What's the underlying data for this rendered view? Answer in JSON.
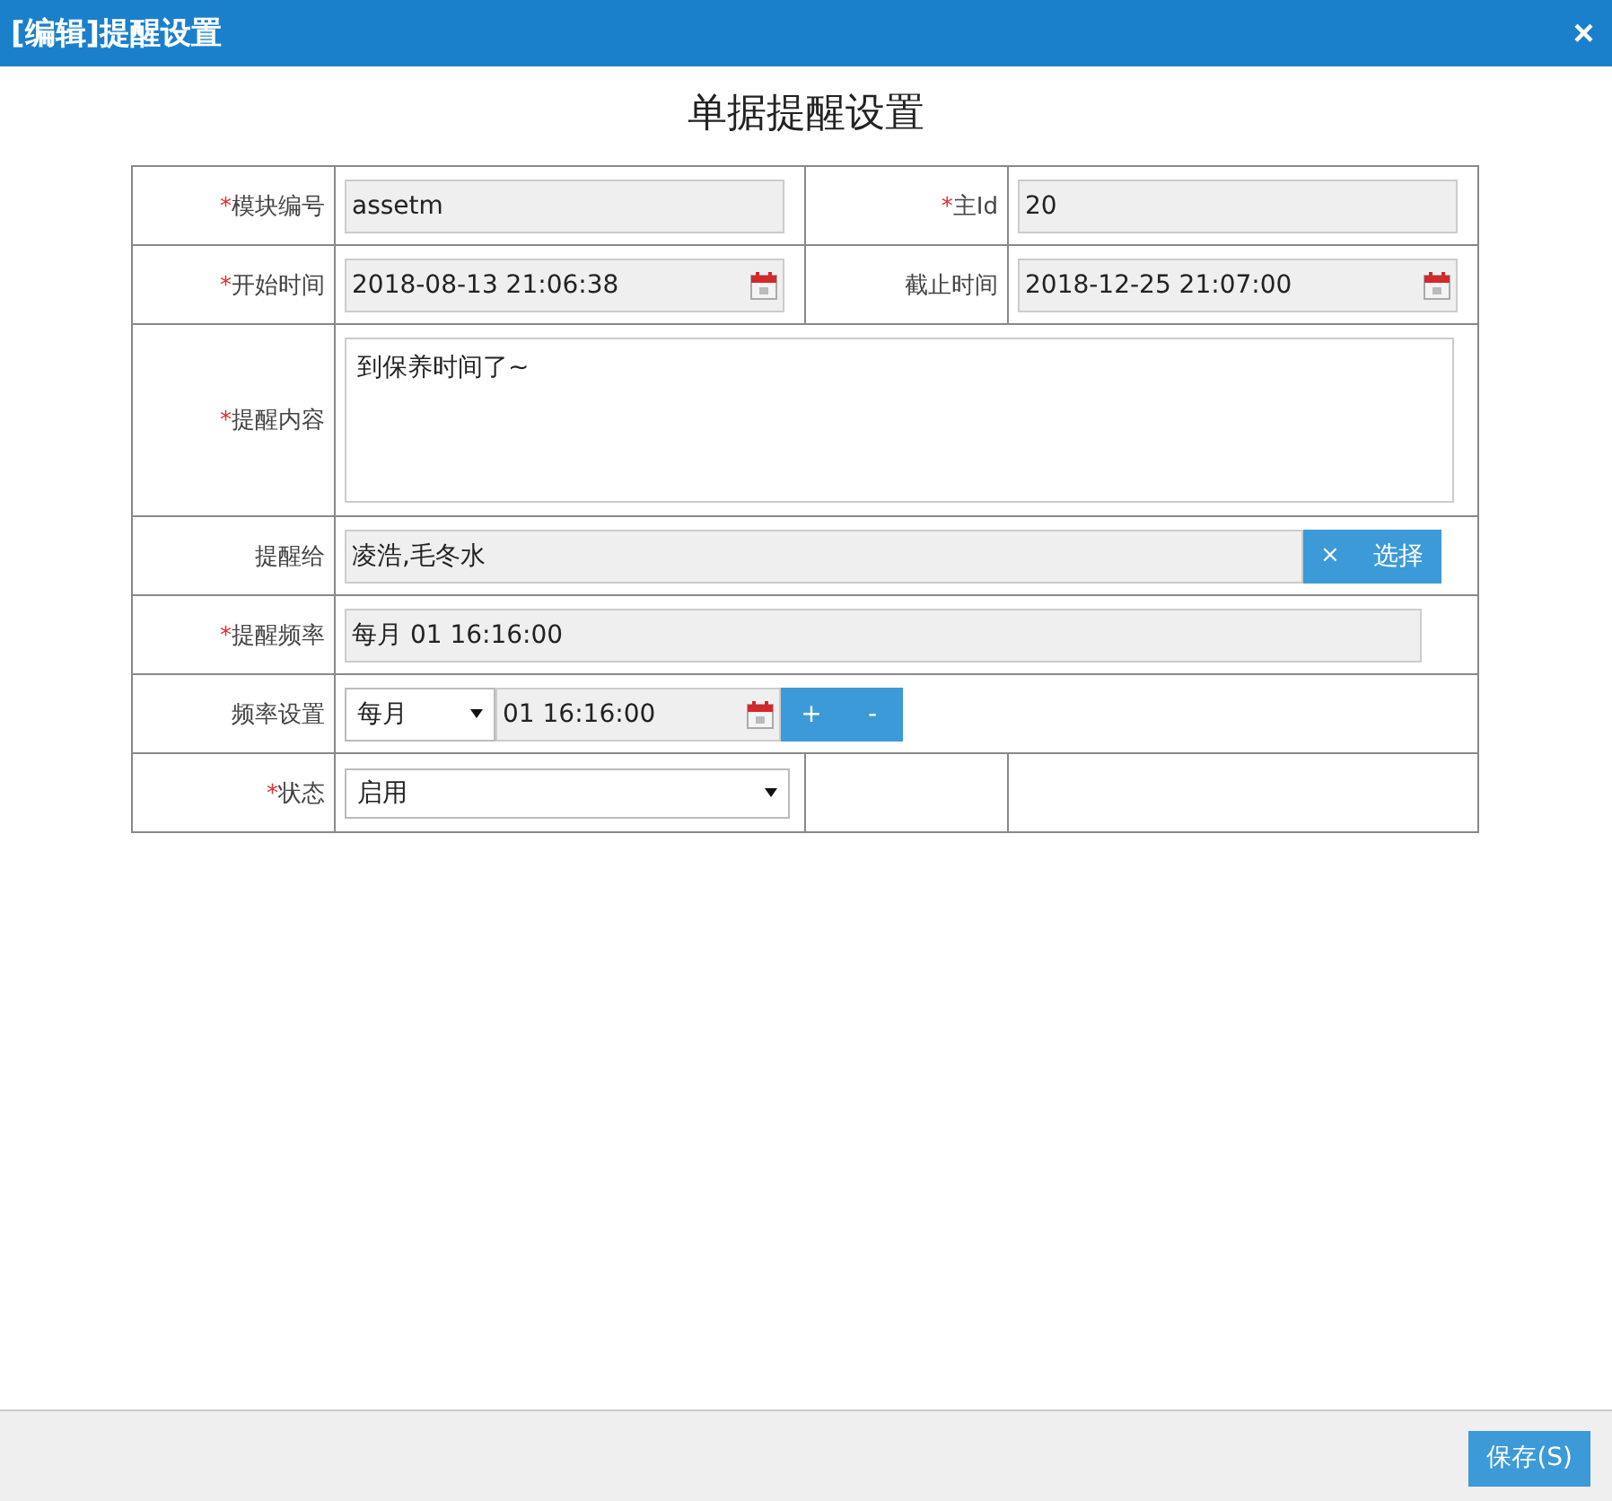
{
  "window": {
    "title": "[编辑]提醒设置",
    "close": "×"
  },
  "form": {
    "title": "单据提醒设置",
    "rows": [
      {
        "kind": "pair",
        "cells": [
          {
            "label": "模块编号",
            "mark": "*",
            "kind": "text",
            "value": "assetm"
          },
          {
            "label": "主Id",
            "mark": "*",
            "kind": "text",
            "value": "20"
          }
        ]
      },
      {
        "kind": "pair",
        "cells": [
          {
            "label": "开始时间",
            "mark": "*",
            "kind": "date",
            "value": "2018-08-13 21:06:38"
          },
          {
            "label": "截止时间",
            "kind": "date",
            "value": "2018-12-25 21:07:00"
          }
        ]
      },
      {
        "kind": "wide",
        "cells": [
          {
            "label": "提醒内容",
            "mark": "*",
            "kind": "textarea",
            "value": "到保养时间了~"
          }
        ]
      },
      {
        "kind": "wide",
        "cells": [
          {
            "label": "提醒给",
            "kind": "picker",
            "value": "凌浩,毛冬水",
            "clear": "×",
            "button": "选择"
          }
        ]
      },
      {
        "kind": "wide",
        "cells": [
          {
            "label": "提醒频率",
            "mark": "*",
            "kind": "text",
            "value": "每月 01 16:16:00"
          }
        ]
      },
      {
        "kind": "wide",
        "cells": [
          {
            "label": "频率设置",
            "kind": "frequency",
            "select": "每月",
            "value": "01 16:16:00",
            "buttons": [
              "+",
              "-"
            ]
          }
        ]
      },
      {
        "kind": "pair",
        "cells": [
          {
            "label": "状态",
            "mark": "*",
            "kind": "select",
            "value": "启用"
          },
          {
            "kind": "empty"
          }
        ]
      }
    ]
  },
  "footer": {
    "buttons": [
      "保存(S)"
    ]
  }
}
